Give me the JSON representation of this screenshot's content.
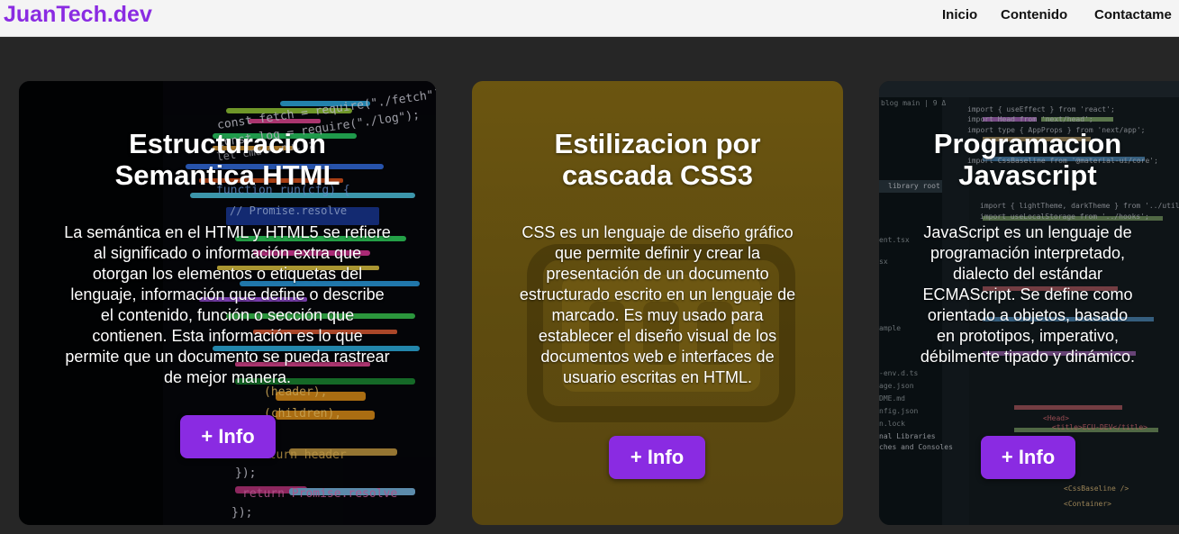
{
  "brand": "JuanTech.dev",
  "nav": {
    "links": [
      "Inicio",
      "Contenido",
      "Contactame"
    ]
  },
  "cards": [
    {
      "title_line1": "Estructuracion",
      "title_line2": "Semantica HTML",
      "text": "La semántica en el HTML y HTML5 se refiere al significado o información extra que otorgan los elementos o etiquetas del lenguaje, información que define o describe el contenido, función o sección que contienen. Esta información es lo que permite que un documento se pueda rastrear de mejor manera.",
      "button": "+ Info"
    },
    {
      "title_line1": "Estilizacion por",
      "title_line2": "cascada CSS3",
      "text": "CSS es un lenguaje de diseño gráfico que permite definir y crear la presentación de un documento estructurado escrito en un lenguaje de marcado. Es muy usado para establecer el diseño visual de los documentos web e interfaces de usuario escritas en HTML.",
      "button": "+ Info"
    },
    {
      "title_line1": "Programacion",
      "title_line2": "Javascript",
      "text": "JavaScript es un lenguaje de programación interpretado, dialecto del estándar ECMAScript. Se define como orientado a objetos, basado en prototipos, imperativo, débilmente tipado y dinámico.",
      "button": "+ Info"
    }
  ],
  "backdrop_code": {
    "card1": [
      "const fetch = require(\"./fetch\");",
      "const log = require(\"./log\");",
      "let cmd = null;",
      "function run(cfg) {",
      "// Promise.resolve",
      "  (header),",
      "  (children),",
      "  return header",
      "});",
      "return Promise.resolve",
      "});"
    ],
    "card3": [
      "import { useEffect } from 'react';",
      "import Head from 'next/head';",
      "import type { AppProps } from 'next/app';",
      "import CssBaseline from '@material-ui/core';",
      "import { lightTheme, darkTheme } from '../utils';",
      "import useLocalStorage from '../hooks';",
      "<Head>",
      "<title>ECU-DEV</title>",
      "<CssBaseline />",
      "<Container>"
    ],
    "card3_files": [
      "blog main | 9 Δ",
      "library root",
      "ent.tsx",
      "sx",
      "ample",
      "-env.d.ts",
      "age.json",
      "DME.md",
      "nfig.json",
      "n.lock",
      "nal Libraries",
      "ches and Consoles"
    ]
  },
  "colors": {
    "accent": "#8a2be2",
    "page_bg": "#262626",
    "navbar_bg": "#f4f4f4",
    "card2_bg": "#6b5510"
  }
}
